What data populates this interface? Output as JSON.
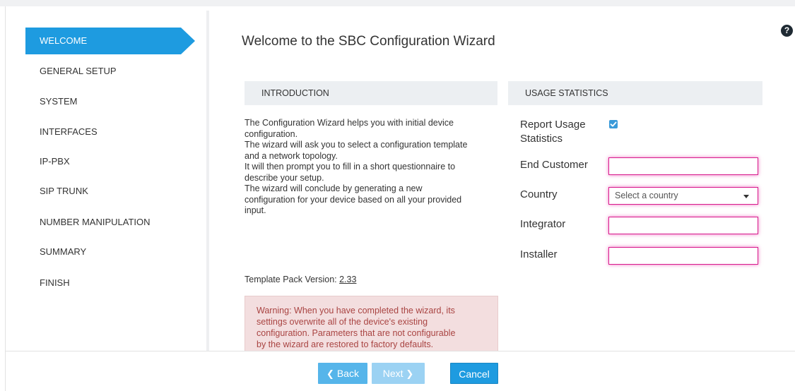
{
  "wizard_title": "Welcome to the SBC Configuration Wizard",
  "steps": [
    {
      "label": "WELCOME"
    },
    {
      "label": "GENERAL SETUP"
    },
    {
      "label": "SYSTEM"
    },
    {
      "label": "INTERFACES"
    },
    {
      "label": "IP-PBX"
    },
    {
      "label": "SIP TRUNK"
    },
    {
      "label": "NUMBER MANIPULATION"
    },
    {
      "label": "SUMMARY"
    },
    {
      "label": "FINISH"
    }
  ],
  "active_step": "WELCOME",
  "introduction": {
    "header": "INTRODUCTION",
    "lines": [
      "The Configuration Wizard helps you with initial device",
      "configuration.",
      "The wizard will ask you to select a configuration template",
      "and a network topology.",
      "It will then prompt you to fill in a short questionnaire to",
      "describe your setup.",
      "The wizard will conclude by generating a new",
      "configuration for your device based on all your provided",
      "input."
    ],
    "template_version_label": "Template Pack Version:",
    "template_version": "2.33",
    "warning_lines": [
      "Warning: When you have completed the wizard, its",
      "settings overwrite all of the device's existing",
      "configuration. Parameters that are not configurable",
      "by the wizard are restored to factory defaults."
    ]
  },
  "usage_statistics": {
    "header": "USAGE STATISTICS",
    "report_label_line1": "Report Usage",
    "report_label_line2": "Statistics",
    "report_checked": true,
    "end_customer_label": "End Customer",
    "end_customer_value": "",
    "country_label": "Country",
    "country_placeholder": "Select a country",
    "integrator_label": "Integrator",
    "integrator_value": "",
    "installer_label": "Installer",
    "installer_value": ""
  },
  "buttons": {
    "back": "Back",
    "next": "Next",
    "cancel": "Cancel"
  },
  "help_icon_glyph": "?",
  "colors": {
    "accent": "#1e9be0",
    "invalid_border": "#d81b8c",
    "warning_bg": "#f3dedf",
    "warning_text": "#a94442"
  }
}
